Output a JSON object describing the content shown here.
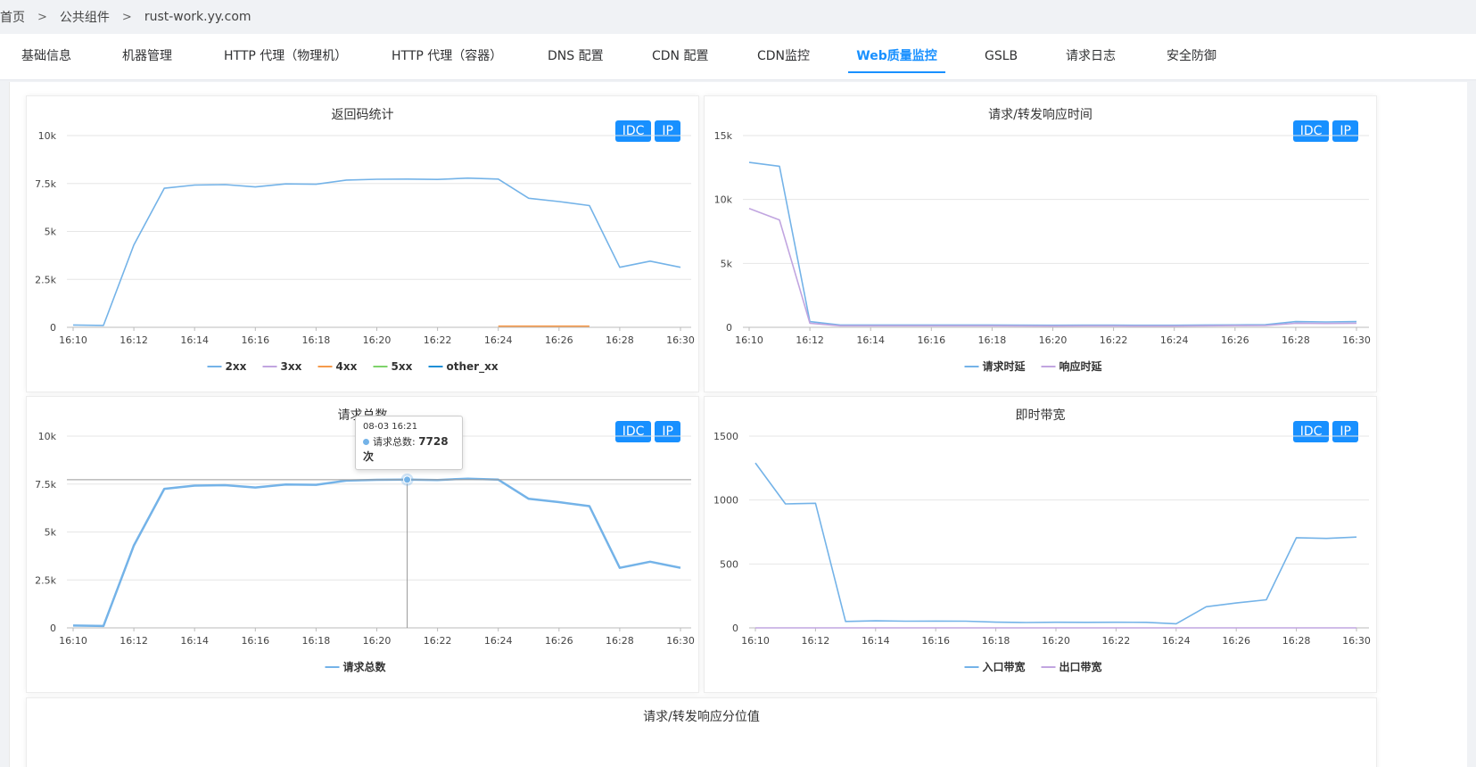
{
  "breadcrumb": [
    "首页",
    "公共组件",
    "rust-work.yy.com"
  ],
  "tabs": [
    {
      "label": "基础信息"
    },
    {
      "label": "机器管理"
    },
    {
      "label": "HTTP 代理（物理机）"
    },
    {
      "label": "HTTP 代理（容器）"
    },
    {
      "label": "DNS 配置"
    },
    {
      "label": "CDN 配置"
    },
    {
      "label": "CDN监控"
    },
    {
      "label": "Web质量监控",
      "active": true
    },
    {
      "label": "GSLB"
    },
    {
      "label": "请求日志"
    },
    {
      "label": "安全防御"
    }
  ],
  "buttons": {
    "idc": "IDC",
    "ip": "IP"
  },
  "bottom_panel_title": "请求/转发响应分位值",
  "colors": {
    "accent": "#1890ff",
    "series_blue": "#74b3e8",
    "series_purple": "#c1a5e0",
    "series_orange": "#f59a4b",
    "series_green": "#7ed36a",
    "series_darkblue": "#1f8fd6"
  },
  "tooltip": {
    "title": "08-03 16:21",
    "label": "请求总数: ",
    "value": "7728次"
  },
  "chart_data": [
    {
      "type": "line",
      "title": "返回码统计",
      "x": [
        "16:10",
        "16:11",
        "16:12",
        "16:13",
        "16:14",
        "16:15",
        "16:16",
        "16:17",
        "16:18",
        "16:19",
        "16:20",
        "16:21",
        "16:22",
        "16:23",
        "16:24",
        "16:25",
        "16:26",
        "16:27",
        "16:28",
        "16:29",
        "16:30"
      ],
      "xticks": [
        "16:10",
        "16:12",
        "16:14",
        "16:16",
        "16:18",
        "16:20",
        "16:22",
        "16:24",
        "16:26",
        "16:28",
        "16:30"
      ],
      "yticks": [
        "0",
        "2.5k",
        "5k",
        "7.5k",
        "10k"
      ],
      "ylim": [
        0,
        10000
      ],
      "series": [
        {
          "name": "2xx",
          "color": "#74b3e8",
          "values": [
            120,
            100,
            4300,
            7250,
            7420,
            7440,
            7320,
            7480,
            7460,
            7680,
            7720,
            7728,
            7710,
            7780,
            7730,
            6730,
            6560,
            6350,
            3130,
            3450,
            3130
          ]
        },
        {
          "name": "3xx",
          "color": "#c1a5e0",
          "values": []
        },
        {
          "name": "4xx",
          "color": "#f59a4b",
          "values": [
            null,
            null,
            null,
            null,
            null,
            null,
            null,
            null,
            null,
            null,
            null,
            null,
            null,
            null,
            60,
            60,
            60,
            60,
            null,
            null,
            null
          ]
        },
        {
          "name": "5xx",
          "color": "#7ed36a",
          "values": []
        },
        {
          "name": "other_xx",
          "color": "#1f8fd6",
          "values": []
        }
      ]
    },
    {
      "type": "line",
      "title": "请求/转发响应时间",
      "x": [
        "16:10",
        "16:11",
        "16:12",
        "16:13",
        "16:14",
        "16:15",
        "16:16",
        "16:17",
        "16:18",
        "16:19",
        "16:20",
        "16:21",
        "16:22",
        "16:23",
        "16:24",
        "16:25",
        "16:26",
        "16:27",
        "16:28",
        "16:29",
        "16:30"
      ],
      "xticks": [
        "16:10",
        "16:12",
        "16:14",
        "16:16",
        "16:18",
        "16:20",
        "16:22",
        "16:24",
        "16:26",
        "16:28",
        "16:30"
      ],
      "yticks": [
        "0",
        "5k",
        "10k",
        "15k"
      ],
      "ylim": [
        0,
        15000
      ],
      "series": [
        {
          "name": "请求时延",
          "color": "#74b3e8",
          "values": [
            12900,
            12600,
            450,
            180,
            180,
            180,
            180,
            180,
            180,
            170,
            160,
            170,
            170,
            160,
            160,
            180,
            190,
            200,
            450,
            420,
            450
          ]
        },
        {
          "name": "响应时延",
          "color": "#c1a5e0",
          "values": [
            9300,
            8400,
            320,
            120,
            120,
            120,
            120,
            120,
            120,
            110,
            100,
            110,
            110,
            100,
            100,
            120,
            130,
            140,
            320,
            300,
            320
          ]
        }
      ]
    },
    {
      "type": "line",
      "title": "请求总数",
      "x": [
        "16:10",
        "16:11",
        "16:12",
        "16:13",
        "16:14",
        "16:15",
        "16:16",
        "16:17",
        "16:18",
        "16:19",
        "16:20",
        "16:21",
        "16:22",
        "16:23",
        "16:24",
        "16:25",
        "16:26",
        "16:27",
        "16:28",
        "16:29",
        "16:30"
      ],
      "xticks": [
        "16:10",
        "16:12",
        "16:14",
        "16:16",
        "16:18",
        "16:20",
        "16:22",
        "16:24",
        "16:26",
        "16:28",
        "16:30"
      ],
      "yticks": [
        "0",
        "2.5k",
        "5k",
        "7.5k",
        "10k"
      ],
      "ylim": [
        0,
        10000
      ],
      "series": [
        {
          "name": "请求总数",
          "color": "#74b3e8",
          "values": [
            120,
            100,
            4300,
            7250,
            7420,
            7440,
            7320,
            7480,
            7460,
            7680,
            7720,
            7728,
            7710,
            7780,
            7730,
            6730,
            6560,
            6350,
            3130,
            3450,
            3130
          ]
        }
      ]
    },
    {
      "type": "line",
      "title": "即时带宽",
      "x": [
        "16:10",
        "16:11",
        "16:12",
        "16:13",
        "16:14",
        "16:15",
        "16:16",
        "16:17",
        "16:18",
        "16:19",
        "16:20",
        "16:21",
        "16:22",
        "16:23",
        "16:24",
        "16:25",
        "16:26",
        "16:27",
        "16:28",
        "16:29",
        "16:30"
      ],
      "xticks": [
        "16:10",
        "16:12",
        "16:14",
        "16:16",
        "16:18",
        "16:20",
        "16:22",
        "16:24",
        "16:26",
        "16:28",
        "16:30"
      ],
      "yticks": [
        "0",
        "500",
        "1000",
        "1500"
      ],
      "ylim": [
        0,
        1500
      ],
      "series": [
        {
          "name": "入口带宽",
          "color": "#74b3e8",
          "values": [
            1290,
            970,
            975,
            50,
            55,
            52,
            53,
            52,
            45,
            42,
            44,
            43,
            44,
            43,
            32,
            165,
            195,
            220,
            705,
            700,
            710
          ]
        },
        {
          "name": "出口带宽",
          "color": "#c1a5e0",
          "values": [
            0,
            0,
            0,
            0,
            0,
            0,
            0,
            0,
            0,
            0,
            0,
            0,
            0,
            0,
            0,
            0,
            0,
            0,
            0,
            0,
            0
          ]
        }
      ]
    }
  ]
}
